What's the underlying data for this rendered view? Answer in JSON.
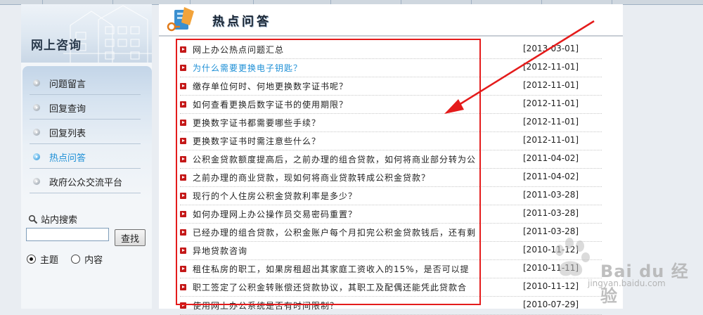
{
  "sidebar": {
    "banner_title": "网上咨询",
    "menu": [
      {
        "label": "问题留言",
        "active": false
      },
      {
        "label": "回复查询",
        "active": false
      },
      {
        "label": "回复列表",
        "active": false
      },
      {
        "label": "热点问答",
        "active": true
      },
      {
        "label": "政府公众交流平台",
        "active": false
      }
    ],
    "search": {
      "heading": "站内搜索",
      "input_value": "",
      "button_label": "查找",
      "options": [
        {
          "label": "主题",
          "checked": true
        },
        {
          "label": "内容",
          "checked": false
        }
      ]
    }
  },
  "main": {
    "title": "热点问答",
    "items": [
      {
        "title": "网上办公热点问题汇总",
        "date": "[2013-03-01]",
        "highlight": false
      },
      {
        "title": "为什么需要更换电子钥匙？",
        "date": "[2012-11-01]",
        "highlight": true
      },
      {
        "title": "缴存单位何时、何地更换数字证书呢？",
        "date": "[2012-11-01]",
        "highlight": false
      },
      {
        "title": "如何查看更换后数字证书的使用期限？",
        "date": "[2012-11-01]",
        "highlight": false
      },
      {
        "title": "更换数字证书都需要哪些手续？",
        "date": "[2012-11-01]",
        "highlight": false
      },
      {
        "title": "更换数字证书时需注意些什么？",
        "date": "[2012-11-01]",
        "highlight": false
      },
      {
        "title": "公积金贷款额度提高后，之前办理的组合贷款，如何将商业部分转为公",
        "date": "[2011-04-02]",
        "highlight": false
      },
      {
        "title": "之前办理的商业贷款，现如何将商业贷款转成公积金贷款？",
        "date": "[2011-04-02]",
        "highlight": false
      },
      {
        "title": "现行的个人住房公积金贷款利率是多少？",
        "date": "[2011-03-28]",
        "highlight": false
      },
      {
        "title": "如何办理网上办公操作员交易密码重置？",
        "date": "[2011-03-28]",
        "highlight": false
      },
      {
        "title": "已经办理的组合贷款，公积金账户每个月扣完公积金贷款钱后，还有剩",
        "date": "[2011-03-28]",
        "highlight": false
      },
      {
        "title": "异地贷款咨询",
        "date": "[2010-11-12]",
        "highlight": false
      },
      {
        "title": "租住私房的职工，如果房租超出其家庭工资收入的15%，是否可以提",
        "date": "[2010-11-11]",
        "highlight": false
      },
      {
        "title": "职工签定了公积金转账偿还贷款协议，其职工及配偶还能凭此贷款合",
        "date": "[2010-11-12]",
        "highlight": false
      },
      {
        "title": "使用网上办公系统是否有时间限制？",
        "date": "[2010-07-29]",
        "highlight": false
      }
    ]
  },
  "watermark": {
    "brand": "Bai du 经验",
    "url": "jingyan.baidu.com"
  },
  "colors": {
    "accent": "#1d8fd6",
    "bullet": "#c41818",
    "annotation": "#e41b1b"
  }
}
